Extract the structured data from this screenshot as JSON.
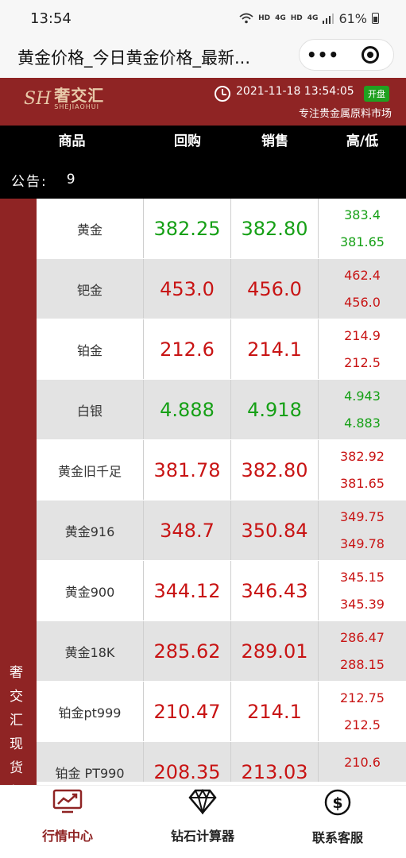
{
  "status_bar": {
    "time": "13:54",
    "network_badges": [
      "HD",
      "4G",
      "HD",
      "4G"
    ],
    "battery": "61%"
  },
  "nav": {
    "title": "黄金价格_今日黄金价格_最新...",
    "more_label": "•••"
  },
  "brand": {
    "logo_mark": "SH",
    "logo_cn": "奢交汇",
    "logo_en": "SHEJIAOHUI",
    "datetime": "2021-11-18 13:54:05",
    "status_badge": "开盘",
    "subtitle": "专注贵金属原料市场"
  },
  "table_header": {
    "product": "商品",
    "buyback": "回购",
    "sell": "销售",
    "high_low": "高/低"
  },
  "notice": {
    "label": "公告:",
    "text": "9"
  },
  "sidebar_text": "奢交汇现货行",
  "rows": [
    {
      "name": "黄金",
      "buy": "382.25",
      "sell": "382.80",
      "high": "383.4",
      "low": "381.65",
      "color": "green"
    },
    {
      "name": "钯金",
      "buy": "453.0",
      "sell": "456.0",
      "high": "462.4",
      "low": "456.0",
      "color": "red"
    },
    {
      "name": "铂金",
      "buy": "212.6",
      "sell": "214.1",
      "high": "214.9",
      "low": "212.5",
      "color": "red"
    },
    {
      "name": "白银",
      "buy": "4.888",
      "sell": "4.918",
      "high": "4.943",
      "low": "4.883",
      "color": "green"
    },
    {
      "name": "黄金旧千足",
      "buy": "381.78",
      "sell": "382.80",
      "high": "382.92",
      "low": "381.65",
      "color": "red"
    },
    {
      "name": "黄金916",
      "buy": "348.7",
      "sell": "350.84",
      "high": "349.75",
      "low": "349.78",
      "color": "red"
    },
    {
      "name": "黄金900",
      "buy": "344.12",
      "sell": "346.43",
      "high": "345.15",
      "low": "345.39",
      "color": "red"
    },
    {
      "name": "黄金18K",
      "buy": "285.62",
      "sell": "289.01",
      "high": "286.47",
      "low": "288.15",
      "color": "red"
    },
    {
      "name": "铂金pt999",
      "buy": "210.47",
      "sell": "214.1",
      "high": "212.75",
      "low": "212.5",
      "color": "red"
    },
    {
      "name": "铂金 PT990",
      "buy": "208.35",
      "sell": "213.03",
      "high": "210.6",
      "low": "",
      "color": "red"
    }
  ],
  "tabs": [
    {
      "label": "行情中心",
      "icon": "chart-monitor-icon",
      "active": true
    },
    {
      "label": "钻石计算器",
      "icon": "diamond-icon",
      "active": false
    },
    {
      "label": "联系客服",
      "icon": "dollar-icon",
      "active": false
    }
  ],
  "colors": {
    "brand_red": "#8f2424",
    "price_green": "#16a016",
    "price_red": "#c81414",
    "open_badge": "#20a020"
  }
}
